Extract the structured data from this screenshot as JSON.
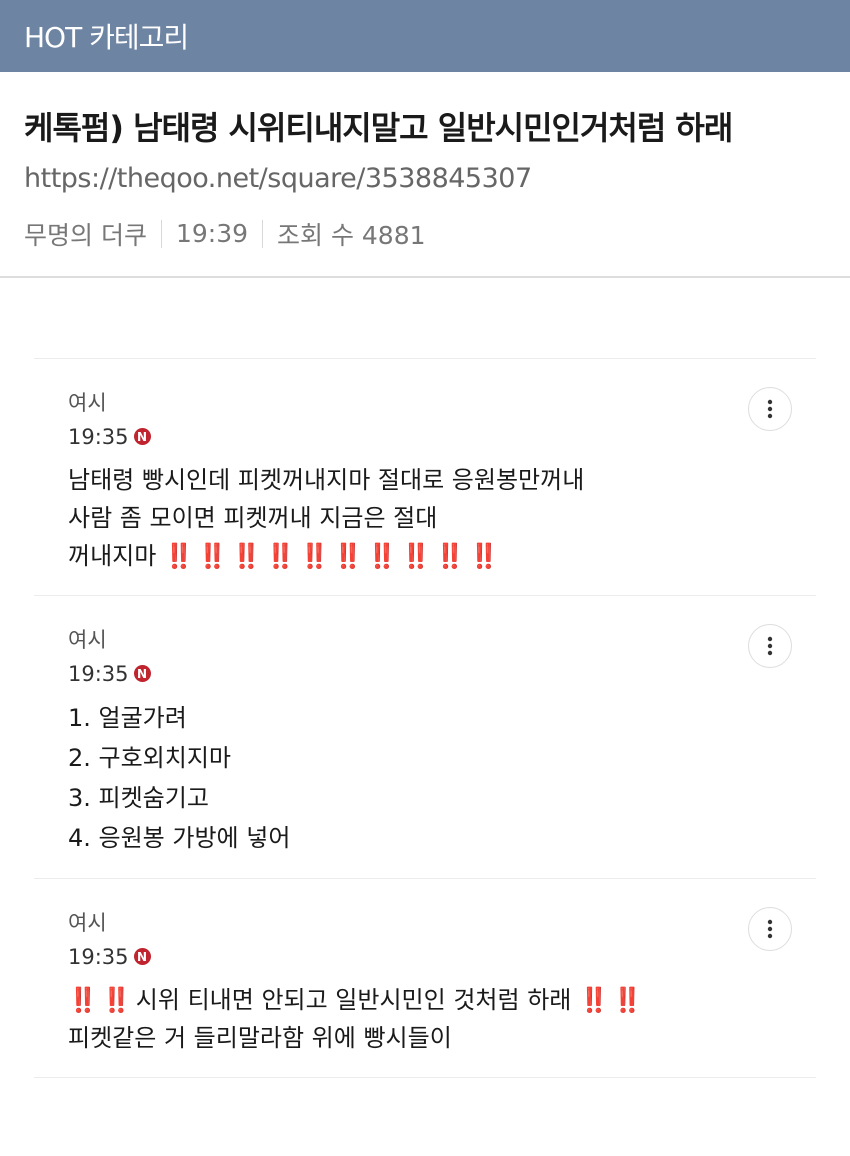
{
  "topbar": {
    "title": "HOT 카테고리"
  },
  "post": {
    "title": "케톡펌) 남태령 시위티내지말고 일반시민인거처럼 하래",
    "url": "https://theqoo.net/square/3538845307",
    "author": "무명의 더쿠",
    "time": "19:39",
    "views_label": "조회 수 4881"
  },
  "comments": [
    {
      "author": "여시",
      "time": "19:35",
      "badge": "N",
      "lines": [
        "남태령 빵시인데 피켓꺼내지마 절대로 응원봉만꺼내",
        "사람 좀 모이면 피켓꺼내 지금은 절대",
        "꺼내지마"
      ],
      "trailing_emoji": "‼️",
      "trailing_emoji_count": 10
    },
    {
      "author": "여시",
      "time": "19:35",
      "badge": "N",
      "lines": [
        "1. 얼굴가려",
        "2. 구호외치지마",
        "3. 피켓숨기고",
        "4. 응원봉 가방에 넣어"
      ]
    },
    {
      "author": "여시",
      "time": "19:35",
      "badge": "N",
      "lines": [
        "시위 티내면 안되고 일반시민인 것처럼 하래",
        "피켓같은 거 들리말라함 위에 빵시들이"
      ],
      "emoji": "‼️"
    }
  ],
  "colors": {
    "topbar": "#6e84a3",
    "badge": "#c0242f",
    "exclamation": "#d6274a"
  },
  "icons": {
    "more": "more-vertical-icon",
    "badge": "new-badge-icon"
  }
}
